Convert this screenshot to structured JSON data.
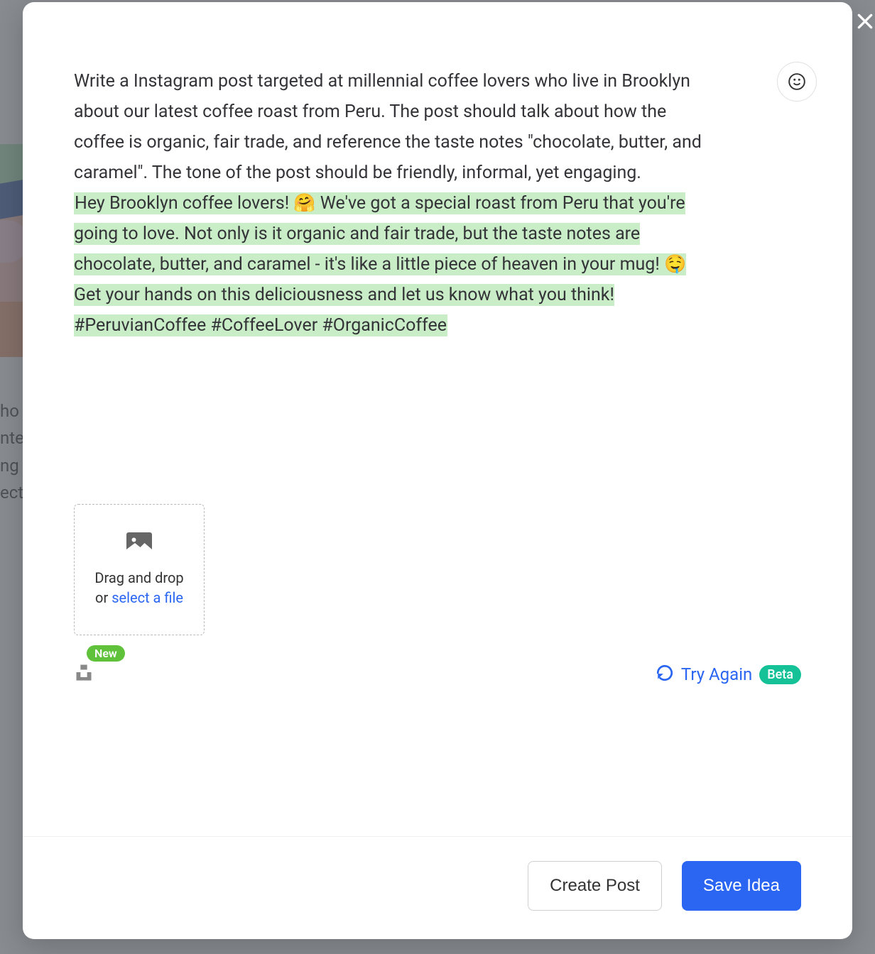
{
  "background": {
    "text_fragment": "ho\nnte\nng\nect"
  },
  "modal": {
    "prompt_text": "Write a Instagram post targeted at millennial coffee lovers who live in Brooklyn about our latest coffee roast from Peru. The post should talk about how the coffee is organic, fair trade, and reference the taste notes \"chocolate, butter, and caramel\". The tone of the post should be friendly, informal, yet engaging.",
    "generated_text": "Hey Brooklyn coffee lovers! 🤗 We've got a special roast from Peru that you're going to love. Not only is it organic and fair trade, but the taste notes are chocolate, butter, and caramel - it's like a little piece of heaven in your mug! 🤤 Get your hands on this deliciousness and let us know what you think! #PeruvianCoffee #CoffeeLover #OrganicCoffee",
    "dropzone": {
      "drag_label": "Drag and drop",
      "or_label": "or ",
      "select_label": "select a file"
    },
    "badges": {
      "new_label": "New",
      "beta_label": "Beta"
    },
    "try_again_label": "Try Again",
    "footer": {
      "create_post_label": "Create Post",
      "save_idea_label": "Save Idea"
    }
  }
}
